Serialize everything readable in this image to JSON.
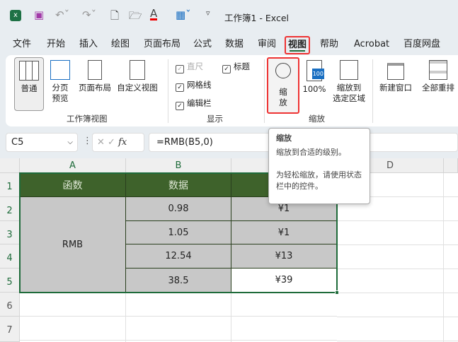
{
  "titlebar": {
    "title": "工作簿1  -  Excel",
    "icons": [
      "excel-logo-icon",
      "save-icon",
      "undo-icon",
      "redo-icon",
      "new-file-icon",
      "open-folder-icon",
      "font-color-icon",
      "borders-icon",
      "customize-qat-icon"
    ]
  },
  "tabs": [
    "文件",
    "开始",
    "插入",
    "绘图",
    "页面布局",
    "公式",
    "数据",
    "审阅",
    "视图",
    "帮助",
    "Acrobat",
    "百度网盘"
  ],
  "active_tab": "视图",
  "ribbon": {
    "workbook_views": {
      "label": "工作簿视图",
      "buttons": [
        "普通",
        "分页\n预览",
        "页面布局",
        "自定义视图"
      ]
    },
    "show": {
      "label": "显示",
      "ruler": "直尺",
      "gridlines": "网格线",
      "formula_bar": "编辑栏",
      "headings": "标题",
      "ruler_checked": true,
      "gridlines_checked": true,
      "formula_bar_checked": true,
      "headings_checked": true
    },
    "zoom": {
      "label": "缩放",
      "zoom_btn": "缩\n放",
      "hundred": "100%",
      "zoom_sel": "缩放到\n选定区域",
      "hundred_icon_text": "100"
    },
    "window": {
      "new_window": "新建窗口",
      "arrange_all": "全部重排"
    }
  },
  "formula_bar": {
    "name_box": "C5",
    "formula": "=RMB(B5,0)",
    "fx": "fx"
  },
  "tooltip": {
    "title": "缩放",
    "desc": "缩放到合适的级别。",
    "hint": "为轻松缩放，请使用状态栏中的控件。"
  },
  "sheet": {
    "columns": [
      "A",
      "B",
      "",
      "D"
    ],
    "rows": [
      "1",
      "2",
      "3",
      "4",
      "5",
      "6",
      "7"
    ],
    "header": [
      "函数",
      "数据",
      ""
    ],
    "a_merged": "RMB",
    "b": [
      "0.98",
      "1.05",
      "12.54",
      "38.5"
    ],
    "c": [
      "¥1",
      "¥1",
      "¥13",
      "¥39"
    ]
  },
  "colors": {
    "header_green": "#3e622b",
    "selection": "#1e6b3a",
    "highlight_red": "#e33"
  }
}
